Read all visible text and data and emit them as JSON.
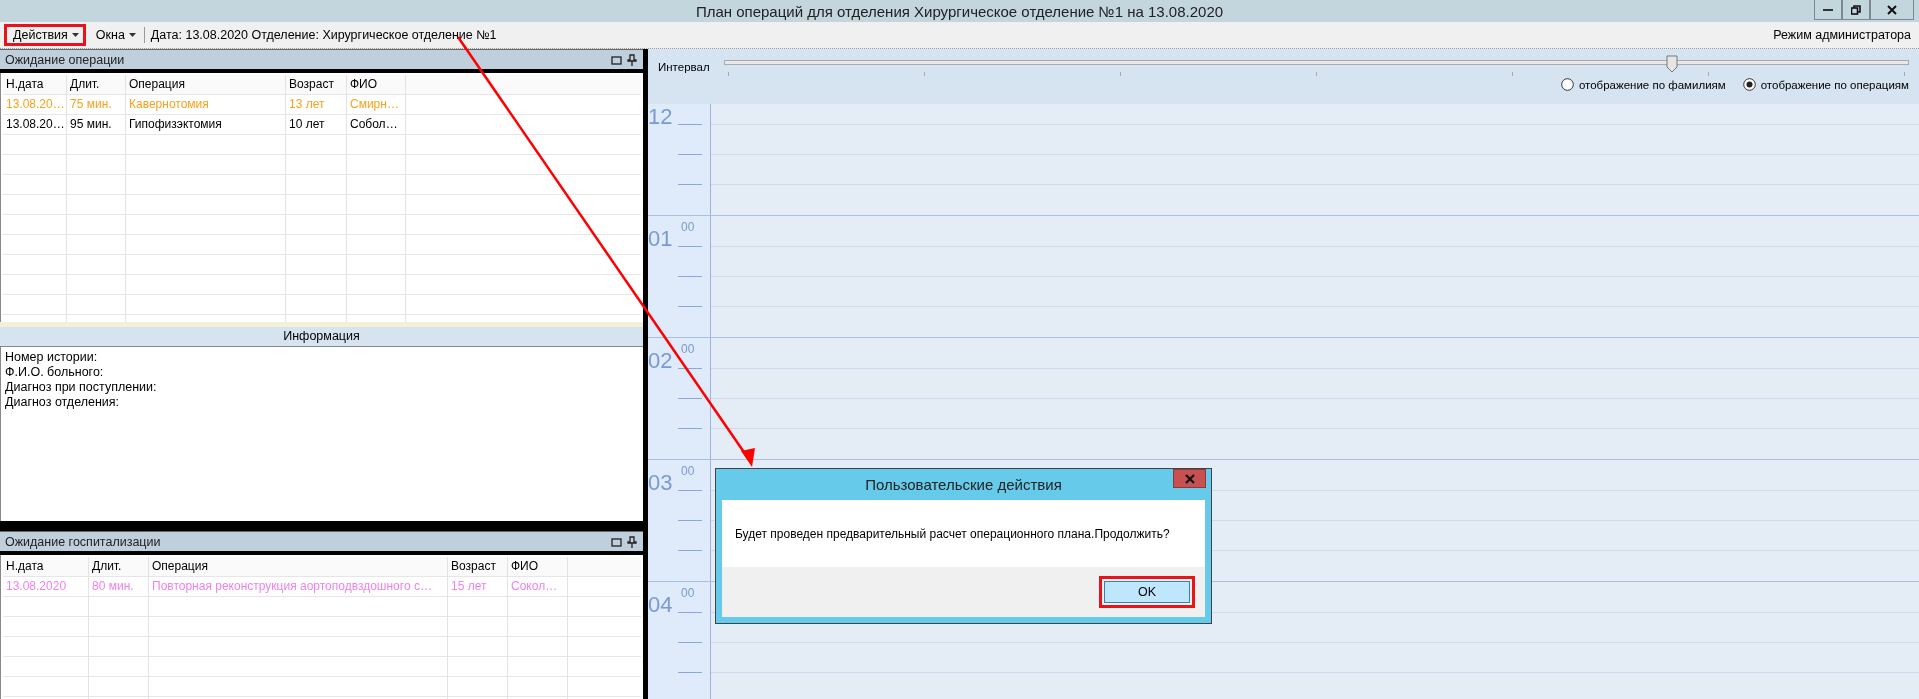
{
  "window": {
    "title": "План операций для отделения Хирургическое отделение №1 на 13.08.2020"
  },
  "menu": {
    "items": [
      {
        "label": "Действия",
        "highlighted": true
      },
      {
        "label": "Окна",
        "highlighted": false
      }
    ],
    "info": "Дата: 13.08.2020 Отделение: Хирургическое отделение №1",
    "mode": "Режим администратора"
  },
  "panels": [
    {
      "kind": "table",
      "title": "Ожидание операции",
      "columns": [
        "Н.дата",
        "Длит.",
        "Операция",
        "Возраст",
        "ФИО"
      ],
      "rows": [
        {
          "color": "#f7a21b",
          "cells": [
            "13.08.20…",
            "75 мин.",
            "Кавернотомия",
            "13 лет",
            "Смирн…"
          ]
        },
        {
          "color": "#000000",
          "cells": [
            "13.08.20…",
            "95 мин.",
            "Гипофизэктомия",
            "10 лет",
            "Собол…"
          ]
        }
      ]
    },
    {
      "kind": "info",
      "title": "Информация",
      "lines": [
        "Номер истории:",
        "Ф.И.О. больного:",
        "Диагноз при поступлении:",
        "Диагноз отделения:"
      ]
    },
    {
      "kind": "table",
      "title": "Ожидание госпитализации",
      "columns": [
        "Н.дата",
        "Длит.",
        "Операция",
        "Возраст",
        "ФИО"
      ],
      "rows": [
        {
          "color": "#ee82ee",
          "cells": [
            "13.08.2020",
            "80 мин.",
            "Повторная реконструкция аортоподвздошного с…",
            "15 лет",
            "Сокол…"
          ]
        }
      ]
    }
  ],
  "schedule": {
    "interval_label": "Интервал",
    "slider": {
      "level": 0.8
    },
    "view_options": [
      {
        "label": "отображение по фамилиям",
        "selected": false
      },
      {
        "label": "отображение по операциям",
        "selected": true
      }
    ],
    "hours": [
      {
        "hour": "12"
      },
      {
        "hour": "01",
        "minutes": "00"
      },
      {
        "hour": "02",
        "minutes": "00"
      },
      {
        "hour": "03",
        "minutes": "00"
      },
      {
        "hour": "04",
        "minutes": "00"
      }
    ]
  },
  "dialog": {
    "title": "Пользовательские действия",
    "message": "Будет проведен предварительный расчет операционного плана.Продолжить?",
    "button": {
      "label": "OK",
      "highlighted": true
    }
  }
}
